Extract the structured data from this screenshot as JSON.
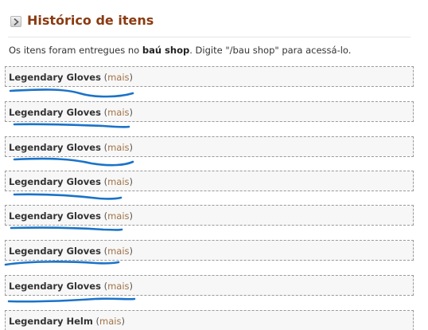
{
  "header": {
    "title": "Histórico de itens",
    "icon": "chevron-right-icon"
  },
  "info": {
    "prefix": "Os itens foram entregues no ",
    "bold": "baú shop",
    "suffix": ". Digite \"/bau shop\" para acessá-lo."
  },
  "items": [
    {
      "name": "Legendary Gloves",
      "more": "mais"
    },
    {
      "name": "Legendary Gloves",
      "more": "mais"
    },
    {
      "name": "Legendary Gloves",
      "more": "mais"
    },
    {
      "name": "Legendary Gloves",
      "more": "mais"
    },
    {
      "name": "Legendary Gloves",
      "more": "mais"
    },
    {
      "name": "Legendary Gloves",
      "more": "mais"
    },
    {
      "name": "Legendary Gloves",
      "more": "mais"
    },
    {
      "name": "Legendary Helm",
      "more": "mais"
    }
  ],
  "colors": {
    "title": "#8a3b12",
    "more_link": "#a07246",
    "annotation": "#1a73c9"
  }
}
